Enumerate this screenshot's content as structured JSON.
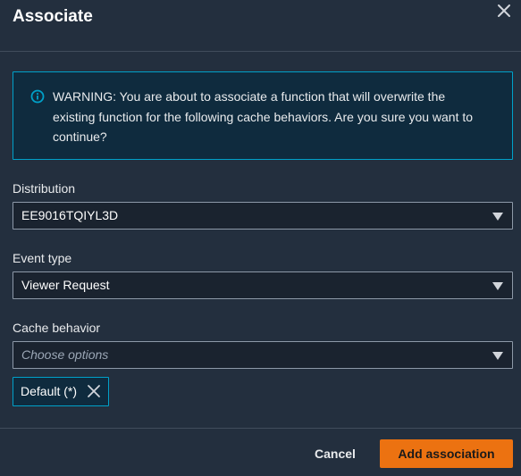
{
  "dialog": {
    "title": "Associate",
    "close_icon": "close-icon"
  },
  "warning": {
    "icon": "info-icon",
    "line1": "WARNING: You are about to associate a function that will overwrite the",
    "line2": "existing function for the following cache behaviors. Are you sure you want to",
    "line3": "continue?"
  },
  "fields": {
    "distribution": {
      "label": "Distribution",
      "value": "EE9016TQIYL3D"
    },
    "event_type": {
      "label": "Event type",
      "value": "Viewer Request"
    },
    "cache_behavior": {
      "label": "Cache behavior",
      "placeholder": "Choose options"
    }
  },
  "tokens": [
    {
      "label": "Default (*)"
    }
  ],
  "footer": {
    "cancel_label": "Cancel",
    "submit_label": "Add association"
  },
  "colors": {
    "background": "#232f3e",
    "accent": "#ec7211",
    "info_border": "#00a1c9",
    "info_bg": "#0f2b3e"
  }
}
